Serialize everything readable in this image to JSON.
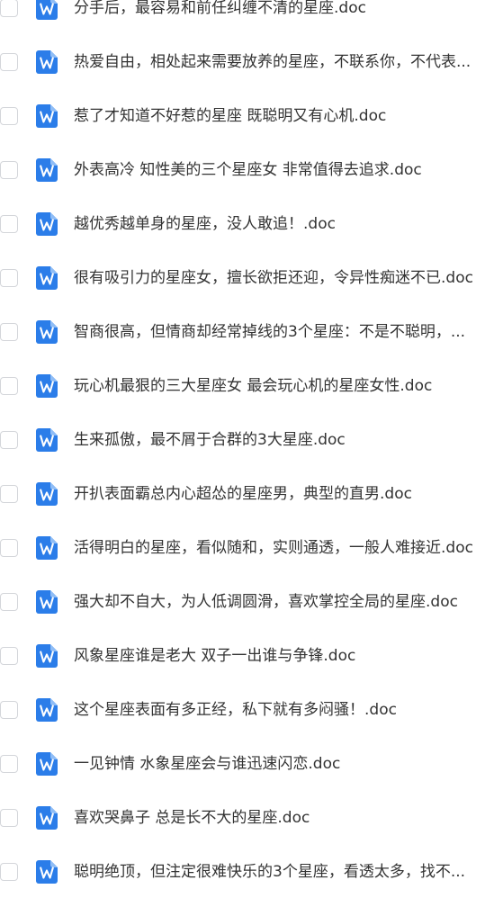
{
  "colors": {
    "text": "#333333",
    "icon_blue": "#2b7de9",
    "checkbox_border": "#d4d6da"
  },
  "icons": {
    "file": "word-doc-icon",
    "checkbox": "checkbox-unchecked"
  },
  "files": [
    {
      "name": "分手后，最容易和前任纠缠不清的星座.doc"
    },
    {
      "name": "热爱自由，相处起来需要放养的星座，不联系你，不代表..."
    },
    {
      "name": "惹了才知道不好惹的星座 既聪明又有心机.doc"
    },
    {
      "name": "外表高冷 知性美的三个星座女 非常值得去追求.doc"
    },
    {
      "name": "越优秀越单身的星座，没人敢追！.doc"
    },
    {
      "name": "很有吸引力的星座女，擅长欲拒还迎，令异性痴迷不已.doc"
    },
    {
      "name": "智商很高，但情商却经常掉线的3个星座：不是不聪明，..."
    },
    {
      "name": "玩心机最狠的三大星座女 最会玩心机的星座女性.doc"
    },
    {
      "name": "生来孤傲，最不屑于合群的3大星座.doc"
    },
    {
      "name": "开扒表面霸总内心超怂的星座男，典型的直男.doc"
    },
    {
      "name": "活得明白的星座，看似随和，实则通透，一般人难接近.doc"
    },
    {
      "name": "强大却不自大，为人低调圆滑，喜欢掌控全局的星座.doc"
    },
    {
      "name": "风象星座谁是老大  双子一出谁与争锋.doc"
    },
    {
      "name": "这个星座表面有多正经，私下就有多闷骚！.doc"
    },
    {
      "name": "一见钟情 水象星座会与谁迅速闪恋.doc"
    },
    {
      "name": "喜欢哭鼻子 总是长不大的星座.doc"
    },
    {
      "name": "聪明绝顶，但注定很难快乐的3个星座，看透太多，找不..."
    }
  ]
}
